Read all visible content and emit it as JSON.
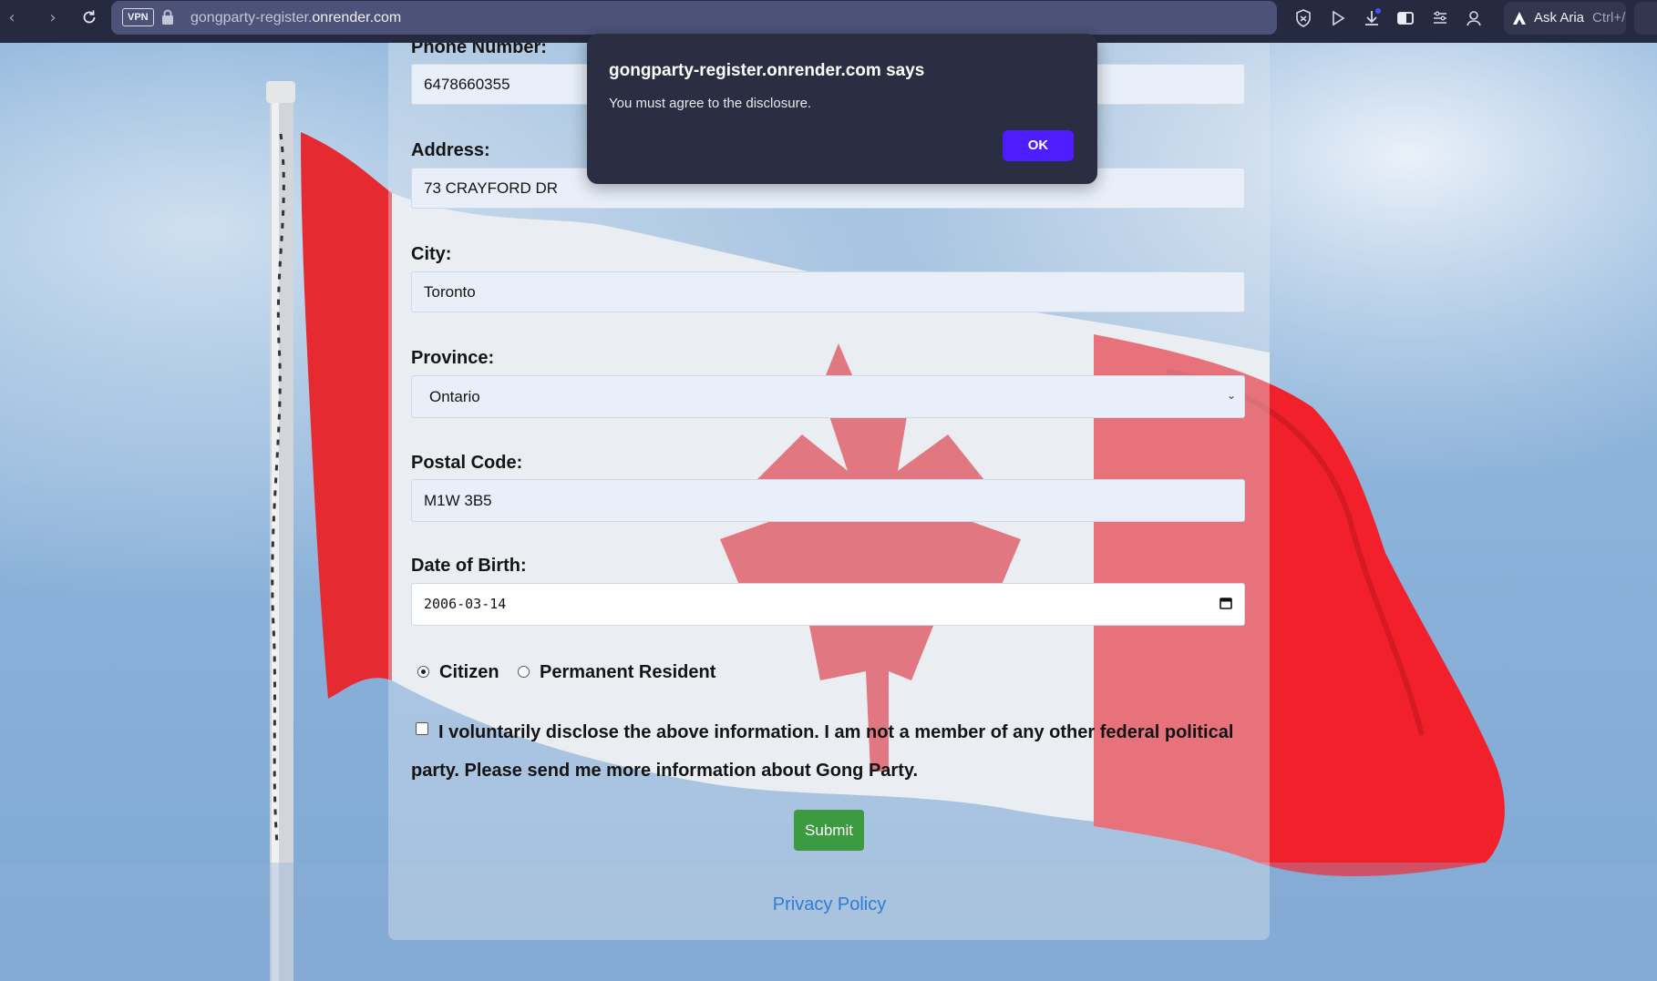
{
  "browser": {
    "vpn_label": "VPN",
    "url_prefix": "gongparty-register.",
    "url_domain": "onrender.com",
    "aria_label": "Ask Aria",
    "aria_hotkey": "Ctrl+/"
  },
  "form": {
    "phone": {
      "label": "Phone Number:",
      "value": "6478660355"
    },
    "address": {
      "label": "Address:",
      "value": "73 CRAYFORD DR"
    },
    "city": {
      "label": "City:",
      "value": "Toronto"
    },
    "province": {
      "label": "Province:",
      "value": "Ontario"
    },
    "postal": {
      "label": "Postal Code:",
      "value": "M1W 3B5"
    },
    "dob": {
      "label": "Date of Birth:",
      "value": "2006-03-14"
    },
    "status": {
      "options": [
        "Citizen",
        "Permanent Resident"
      ],
      "selected": "Citizen"
    },
    "disclosure_text": "I voluntarily disclose the above information. I am not a member of any other federal political party. Please send me more information about Gong Party.",
    "disclosure_checked": false,
    "submit_label": "Submit",
    "privacy_label": "Privacy Policy"
  },
  "dialog": {
    "title": "gongparty-register.onrender.com says",
    "message": "You must agree to the disclosure.",
    "ok_label": "OK"
  },
  "colors": {
    "dialog_bg": "#2b2d42",
    "ok_button": "#4d1dff",
    "submit_button": "#3c9a40",
    "link": "#2f7bd6",
    "flag_red": "#f2202a"
  },
  "icons": [
    "back-icon",
    "forward-icon",
    "reload-icon",
    "lock-icon",
    "shield-icon",
    "play-icon",
    "download-icon",
    "wallet-icon",
    "menu-icon",
    "profile-icon",
    "aria-logo-icon",
    "calendar-icon",
    "chevron-down-icon"
  ]
}
